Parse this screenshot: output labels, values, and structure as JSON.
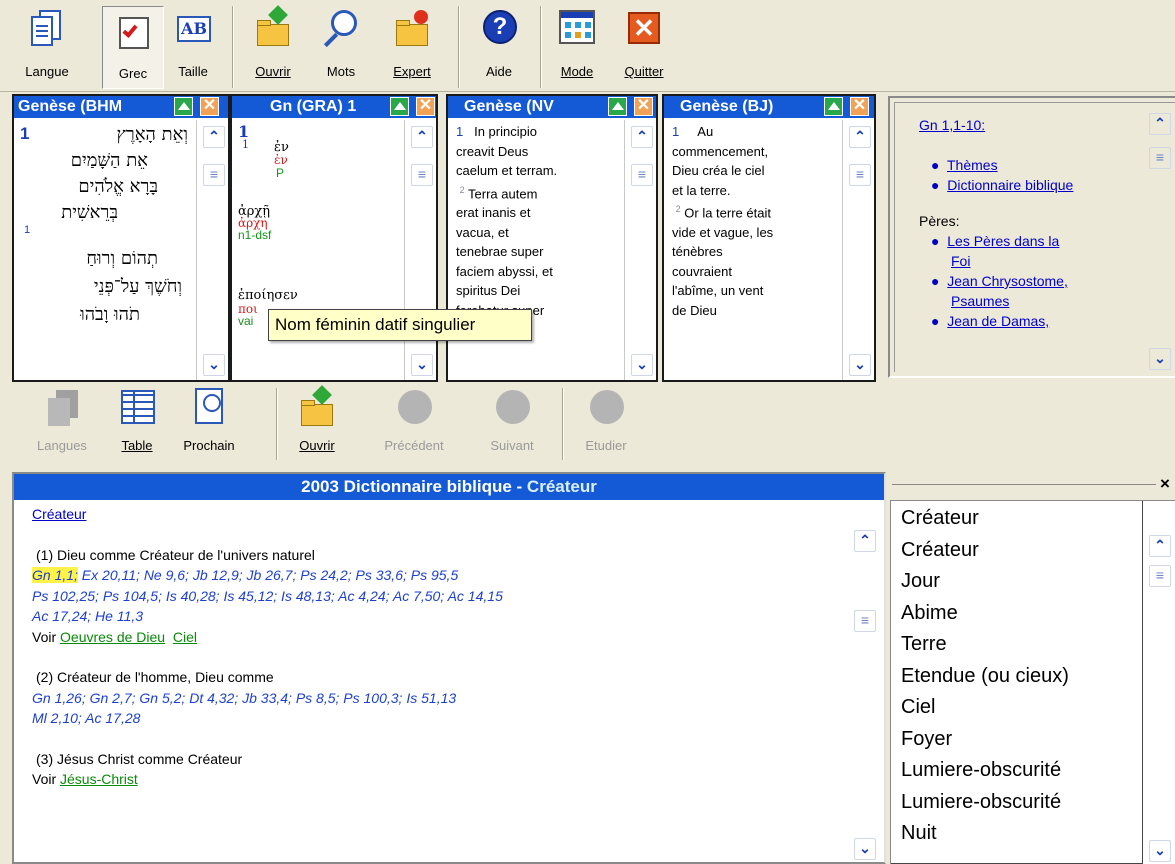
{
  "toolbar_top": {
    "langue": "Langue",
    "grec": "Grec",
    "taille": "Taille",
    "ouvrir": "Ouvrir",
    "mots": "Mots",
    "expert": "Expert",
    "aide": "Aide",
    "mode": "Mode",
    "quitter": "Quitter"
  },
  "toolbar_mid": {
    "langues": "Langues",
    "table": "Table",
    "prochain": "Prochain",
    "ouvrir": "Ouvrir",
    "precedent": "Précédent",
    "suivant": "Suivant",
    "etudier": "Etudier"
  },
  "pane_bhm": {
    "title": "Genèse (BHM",
    "verse_num": "1",
    "lines": [
      "וְאֵת הָאָרֶץ",
      "אֵת הַשָּׁמַיִם",
      "בָּרָא אֱלֹהִים",
      "בְּרֵאשִׁית",
      "תְהוֹם וְרוּחַ",
      "וְחֹשֶׁךְ עַל־פְּנֵי",
      "תֹהוּ וָבֹהוּ"
    ],
    "sub_num": "1"
  },
  "pane_gra": {
    "title": "Gn (GRA) 1",
    "verse_num": "1",
    "sub_num": "1",
    "w1": "ἐν",
    "w1_lemma": "ἐν",
    "w1_parse": "P",
    "w2": "ἀρχῇ",
    "w2_lemma": "ἀρχη",
    "w2_parse": "n1-dsf",
    "w3": "ἐποίησεν",
    "w3_lemma": "ποι",
    "w3_parse": "vai"
  },
  "tooltip": "Nom féminin datif singulier",
  "pane_nv": {
    "title": "Genèse (NV",
    "verse_num": "1",
    "lines": [
      "In principio",
      "creavit Deus",
      "caelum et terram.",
      "Terra autem",
      "erat inanis et",
      "vacua, et",
      "tenebrae super",
      "faciem abyssi, et",
      "spiritus Dei",
      "ferebatur super"
    ],
    "sup2": "2"
  },
  "pane_bj": {
    "title": "Genèse (BJ)",
    "verse_num": "1",
    "lines": [
      "Au",
      "commencement,",
      "Dieu créa le ciel",
      "et la terre.",
      "Or la terre était",
      "vide et vague, les",
      "ténèbres",
      "couvraient",
      "l'abîme, un vent",
      "de Dieu"
    ],
    "sup2": "2"
  },
  "side_links": {
    "ref": "Gn 1,1-10:",
    "themes": "Thèmes",
    "dict": "Dictionnaire biblique",
    "peres_label": "Pères:",
    "peres_foi_1": "Les Pères dans la",
    "peres_foi_2": "Foi",
    "chrys_1": "Jean Chrysostome,",
    "chrys_2": "Psaumes",
    "damas": "Jean de Damas,"
  },
  "dict_pane": {
    "title_prefix": "2003 Dictionnaire biblique - ",
    "title_term": "Créateur",
    "term_link": "Créateur",
    "s1_head": "(1) Dieu comme Créateur de l'univers naturel",
    "s1_first_ref": "Gn 1,1;",
    "s1_refs_a": " Ex 20,11; Ne 9,6; Jb 12,9; Jb 26,7; Ps 24,2; Ps 33,6; Ps 95,5",
    "s1_refs_b": "Ps 102,25; Ps 104,5; Is 40,28; Is 45,12; Is 48,13; Ac 4,24; Ac 7,50; Ac 14,15",
    "s1_refs_c": "Ac 17,24; He 11,3",
    "voir": "Voir",
    "s1_voir_1": "Oeuvres de Dieu",
    "s1_voir_2": "Ciel",
    "s2_head": "(2) Créateur de l'homme, Dieu comme",
    "s2_refs_a": "Gn 1,26; Gn 2,7; Gn 5,2; Dt 4,32; Jb 33,4; Ps 8,5; Ps 100,3; Is 51,13",
    "s2_refs_b": "Ml 2,10; Ac 17,28",
    "s3_head": "(3) Jésus Christ comme Créateur",
    "s3_voir_1": "Jésus-Christ"
  },
  "word_list": [
    "Créateur",
    "Créateur",
    "Jour",
    "Abime",
    "Terre",
    "Etendue (ou cieux)",
    "Ciel",
    "Foyer",
    "Lumiere-obscurité",
    "Lumiere-obscurité",
    "Nuit"
  ],
  "close_glyph": "×"
}
